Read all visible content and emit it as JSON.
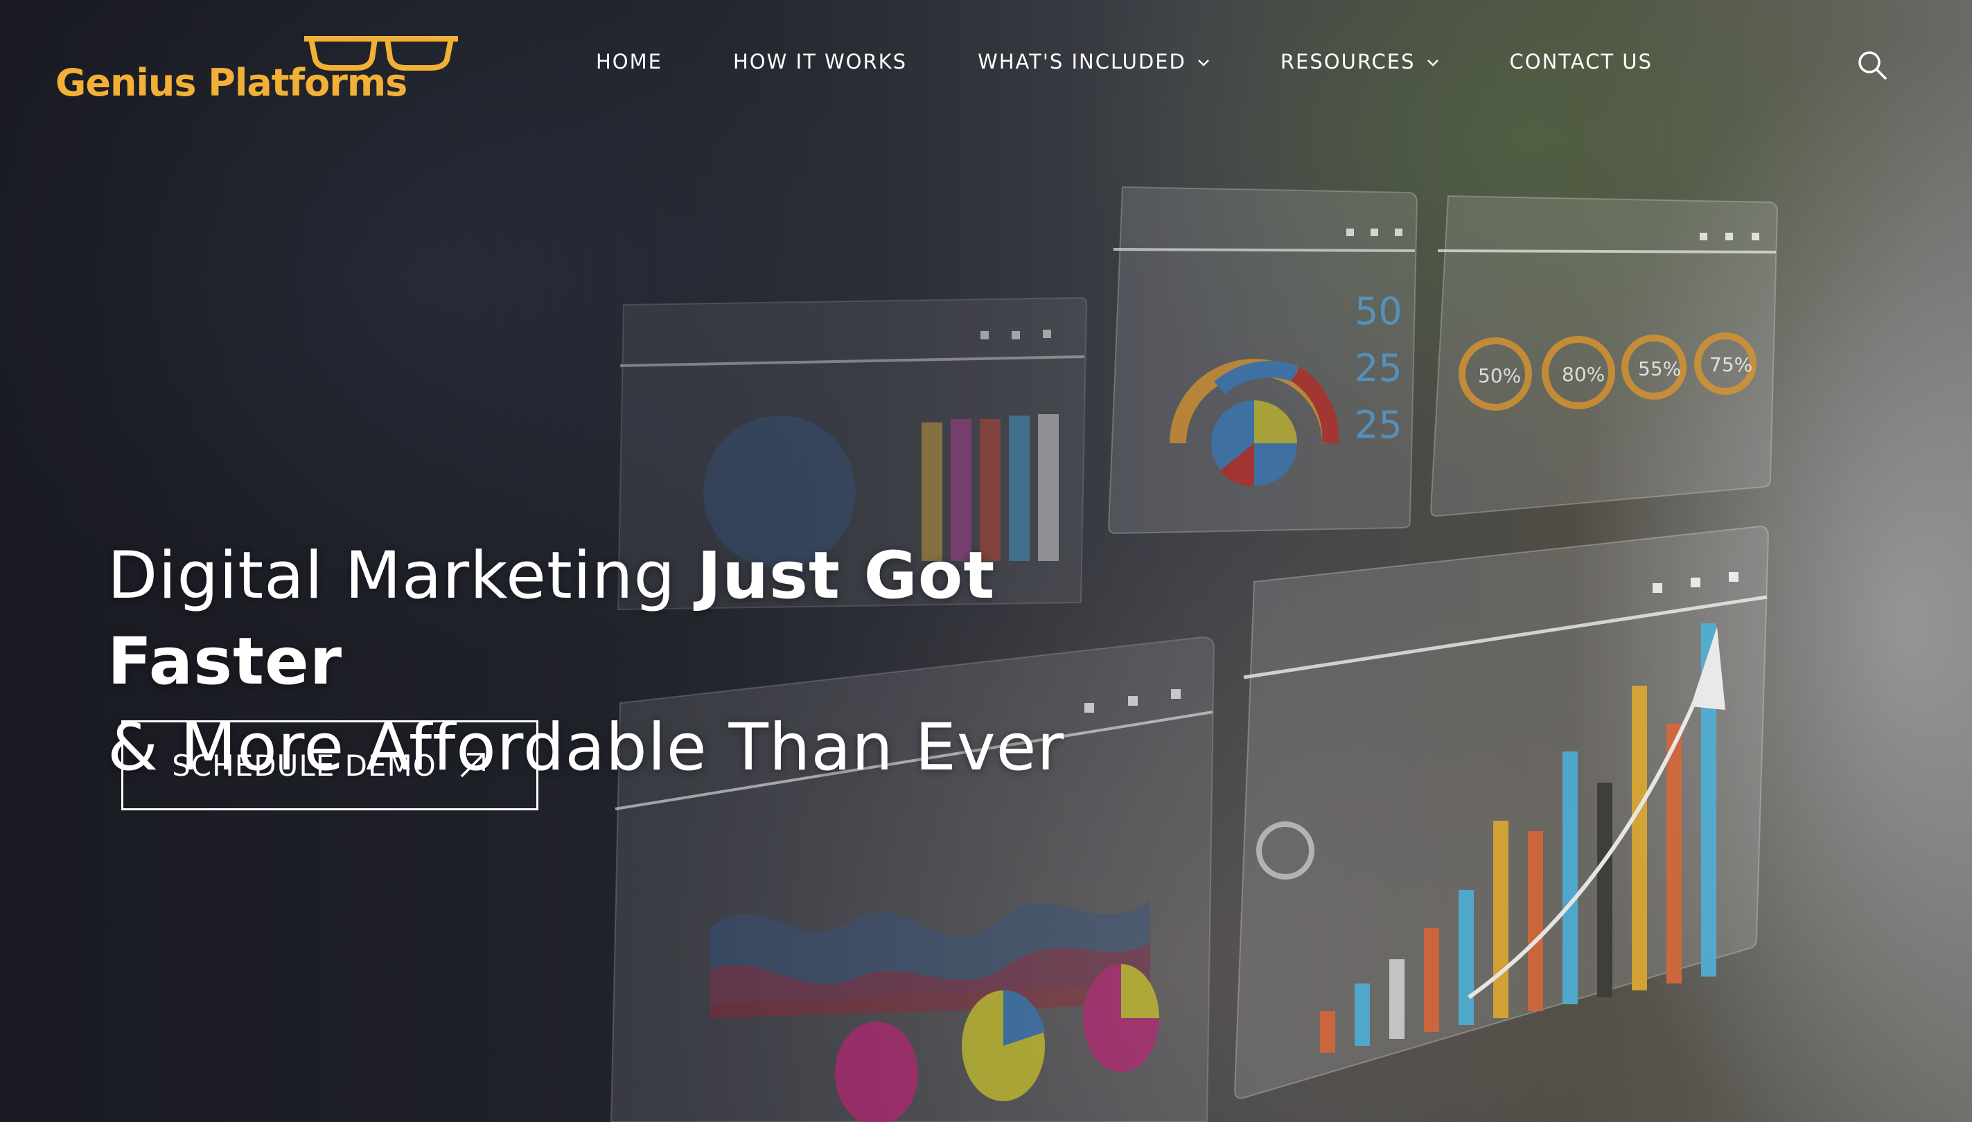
{
  "brand": {
    "name": "Genius Platforms",
    "logo_color": "#f2b136"
  },
  "nav": {
    "items": [
      {
        "label": "HOME",
        "has_dropdown": false
      },
      {
        "label": "HOW IT WORKS",
        "has_dropdown": false
      },
      {
        "label": "WHAT'S INCLUDED",
        "has_dropdown": true
      },
      {
        "label": "RESOURCES",
        "has_dropdown": true
      },
      {
        "label": "CONTACT US",
        "has_dropdown": false
      }
    ],
    "search_icon": "search-icon"
  },
  "hero": {
    "headline_part1": "Digital Marketing ",
    "headline_bold": "Just Got Faster",
    "headline_line2": "& More Affordable Than Ever",
    "cta_label": "SCHEDULE DEMO",
    "cta_icon": "arrow-up-right-icon"
  },
  "dashboard": {
    "donut_labels": [
      "50%",
      "80%",
      "55%",
      "75%"
    ],
    "gauge_numbers": [
      "50",
      "25",
      "25"
    ]
  }
}
